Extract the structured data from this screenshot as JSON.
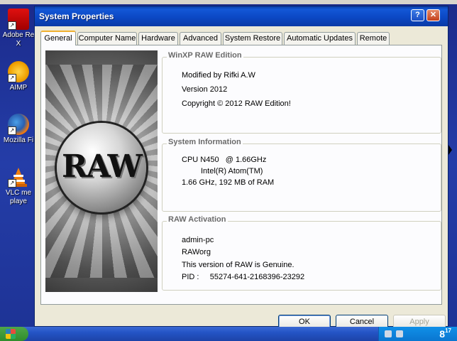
{
  "desktop": {
    "icons": [
      {
        "label_1": "Adobe Re",
        "label_2": "X"
      },
      {
        "label_1": "AIMP",
        "label_2": ""
      },
      {
        "label_1": "Mozilla Fi",
        "label_2": ""
      },
      {
        "label_1": "VLC me",
        "label_2": "playe"
      }
    ]
  },
  "window": {
    "title": "System Properties",
    "help_label": "?",
    "close_label": "✕",
    "tabs": [
      {
        "label": "General"
      },
      {
        "label": "Computer Name"
      },
      {
        "label": "Hardware"
      },
      {
        "label": "Advanced"
      },
      {
        "label": "System Restore"
      },
      {
        "label": "Automatic Updates"
      },
      {
        "label": "Remote"
      }
    ],
    "logo_text": "RAW",
    "edition": {
      "title": "WinXP RAW Edition",
      "line1": "Modified by Rifki A.W",
      "line2": "Version 2012",
      "line3": "Copyright © 2012 RAW Edition!"
    },
    "system": {
      "title": "System Information",
      "cpu": "CPU N450   @ 1.66GHz",
      "cpu_brand": "Intel(R) Atom(TM)",
      "summary": "1.66 GHz, 192 MB of RAM"
    },
    "activation": {
      "title": "RAW Activation",
      "computer": "admin-pc",
      "org": "RAWorg",
      "genuine": "This version of RAW is Genuine.",
      "pid": "PID :     55274-641-2168396-23292"
    },
    "buttons": {
      "ok": "OK",
      "cancel": "Cancel",
      "apply": "Apply"
    }
  },
  "taskbar": {
    "clock_hour": "8",
    "clock_minute": "17"
  }
}
